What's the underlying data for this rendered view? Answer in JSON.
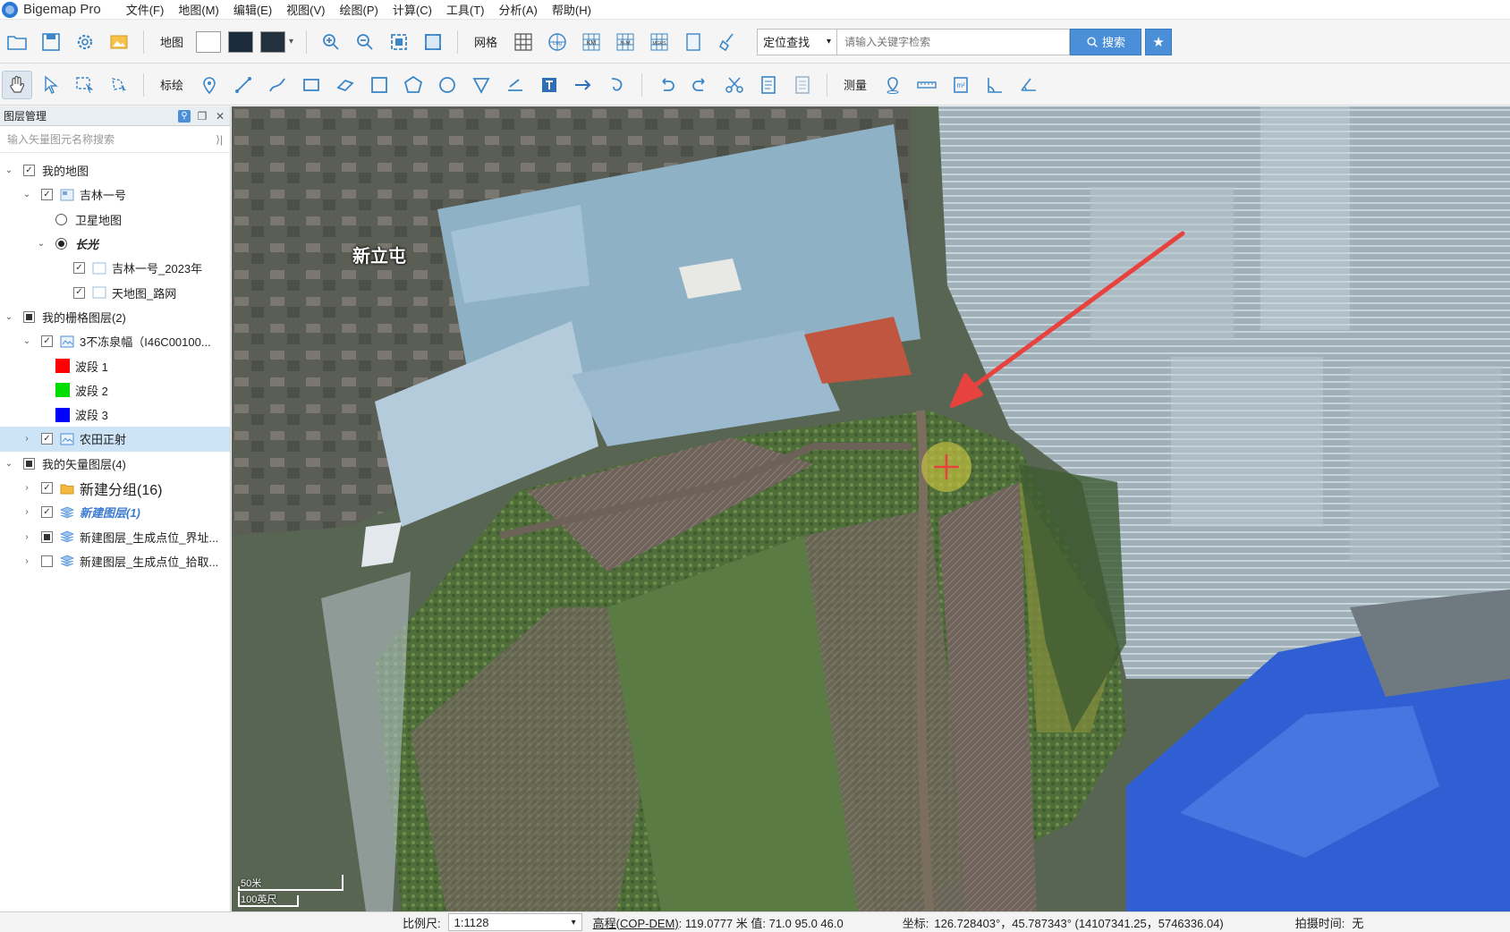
{
  "app": {
    "title": "Bigemap Pro"
  },
  "menu": [
    "文件(F)",
    "地图(M)",
    "编辑(E)",
    "视图(V)",
    "绘图(P)",
    "计算(C)",
    "工具(T)",
    "分析(A)",
    "帮助(H)"
  ],
  "toolbar1": {
    "map_label": "地图",
    "grid_label": "网格",
    "grid_buttons": [
      "Lng",
      "KM",
      "N-M",
      "MGRS"
    ],
    "search_mode": "定位查找",
    "search_placeholder": "请输入关键字检索",
    "search_button": "搜索"
  },
  "toolbar2": {
    "annotate_label": "标绘",
    "measure_label": "测量"
  },
  "panel": {
    "title": "图层管理",
    "search_placeholder": "输入矢量图元名称搜索",
    "tree": {
      "my_map": "我的地图",
      "jilin1": "吉林一号",
      "satellite": "卫星地图",
      "changguang": "长光",
      "jilin_2023": "吉林一号_2023年",
      "tianditu_road": "天地图_路网",
      "raster_group": "我的栅格图层(2)",
      "raster1": "3不冻泉幅（I46C00100...",
      "band1": "波段 1",
      "band2": "波段 2",
      "band3": "波段 3",
      "farmland": "农田正射",
      "vector_group": "我的矢量图层(4)",
      "new_group": "新建分组(16)",
      "new_layer1": "新建图层(1)",
      "gen_point_boundary": "新建图层_生成点位_界址...",
      "gen_point_pick": "新建图层_生成点位_拾取..."
    },
    "band_colors": [
      "#ff0000",
      "#00dd00",
      "#0000ff"
    ]
  },
  "map": {
    "place_label": "新立屯",
    "scale_metric": "50米",
    "scale_imperial": "100英尺"
  },
  "status": {
    "scale_label": "比例尺:",
    "scale_value": "1:1128",
    "elev_label": "高程(COP-DEM)",
    "elev_value": ": 119.0777 米 值: 71.0 95.0 46.0",
    "coord_label": "坐标:",
    "coord_value": "126.728403°，45.787343°  (14107341.25，5746336.04)",
    "capture_label": "拍摄时间:",
    "capture_value": "无"
  },
  "colors": {
    "accent": "#4a8fd8",
    "arrow": "#e8423f",
    "selected_row": "#cde3f6"
  }
}
